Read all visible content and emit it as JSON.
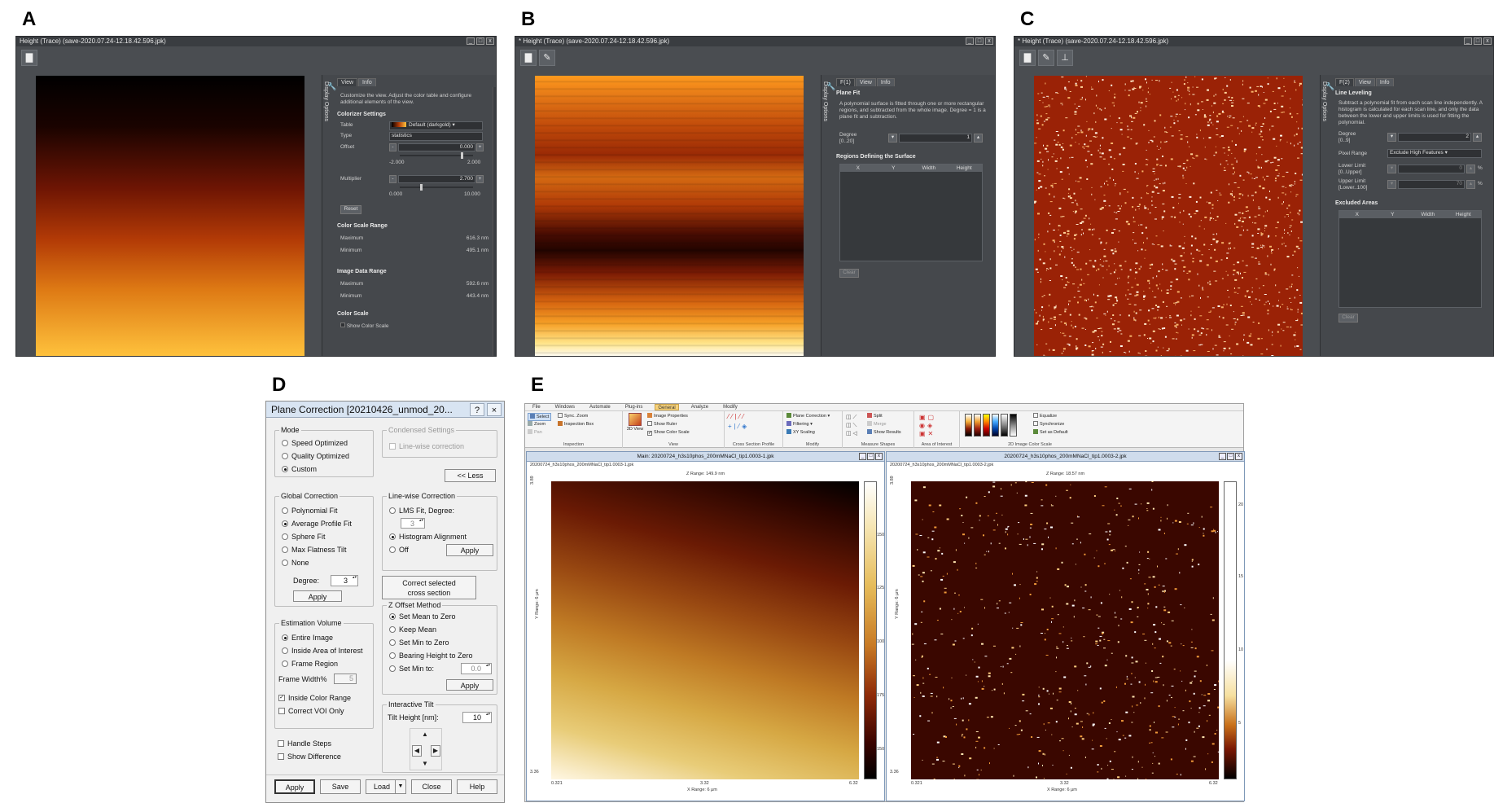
{
  "panel_labels": {
    "a": "A",
    "b": "B",
    "c": "C",
    "d": "D",
    "e": "E"
  },
  "win_a": {
    "title": "Height (Trace) (save-2020.07.24-12.18.42.596.jpk)",
    "side_label": "Display Options",
    "tabs": [
      "View",
      "Info"
    ],
    "intro": "Customize the view. Adjust the color table and configure additional elements of the view.",
    "colorizer_heading": "Colorizer Settings",
    "table_label": "Table",
    "table_value": "Default (darkgold)",
    "type_label": "Type",
    "type_value": "statistics",
    "offset_label": "Offset",
    "offset_value": "0.000",
    "offset_min": "-2.000",
    "offset_max": "2.000",
    "multiplier_label": "Multiplier",
    "multiplier_value": "2.700",
    "mult_min": "0.000",
    "mult_max": "10.000",
    "reset_label": "Reset",
    "csr_heading": "Color Scale Range",
    "csr_max_label": "Maximum",
    "csr_max_value": "616.3 nm",
    "csr_min_label": "Minimum",
    "csr_min_value": "495.1 nm",
    "idr_heading": "Image Data Range",
    "idr_max_label": "Maximum",
    "idr_max_value": "592.6 nm",
    "idr_min_label": "Minimum",
    "idr_min_value": "443.4 nm",
    "cs_heading": "Color Scale",
    "show_cs_label": "Show Color Scale"
  },
  "win_b": {
    "title": "* Height (Trace) (save-2020.07.24-12.18.42.596.jpk)",
    "side_label": "Display Options",
    "tabs": [
      "F(1)",
      "View",
      "Info"
    ],
    "heading": "Plane Fit",
    "intro": "A polynomial surface is fitted through one or more rectangular regions, and subtracted from the whole image. Degree = 1 is a plane fit and subtraction.",
    "degree_label": "Degree",
    "degree_range": "[0..20]",
    "degree_value": "1",
    "regions_heading": "Regions Defining the Surface",
    "cols": [
      "X",
      "Y",
      "Width",
      "Height"
    ],
    "clear_label": "Clear"
  },
  "win_c": {
    "title": "* Height (Trace) (save-2020.07.24-12.18.42.596.jpk)",
    "side_label": "Display Options",
    "tabs": [
      "F(2)",
      "View",
      "Info"
    ],
    "heading": "Line Leveling",
    "intro": "Subtract a polynomial fit from each scan line independently. A histogram is calculated for each scan line, and only the data between the lower and upper limits is used for fitting the polynomial.",
    "degree_label": "Degree",
    "degree_range": "[0..9]",
    "degree_value": "2",
    "pixel_label": "Pixel Range",
    "pixel_value": "Exclude High Features",
    "lower_label": "Lower Limit",
    "lower_range": "[0..Upper]",
    "lower_value": "0",
    "upper_label": "Upper Limit",
    "upper_range": "[Lower..100]",
    "upper_value": "70",
    "pct": "%",
    "excluded_heading": "Excluded Areas",
    "cols": [
      "X",
      "Y",
      "Width",
      "Height"
    ],
    "clear_label": "Clear"
  },
  "pc": {
    "title": "Plane Correction [20210426_unmod_20...",
    "help_q": "?",
    "close_x": "×",
    "mode_label": "Mode",
    "mode_opts": [
      "Speed Optimized",
      "Quality Optimized",
      "Custom"
    ],
    "condensed_label": "Condensed Settings",
    "linewise_check": "Line-wise correction",
    "less_btn": "<< Less",
    "global_label": "Global Correction",
    "global_opts": [
      "Polynomial Fit",
      "Average Profile Fit",
      "Sphere Fit",
      "Max Flatness Tilt",
      "None"
    ],
    "degree_label": "Degree:",
    "degree_value": "3",
    "apply": "Apply",
    "lw_label": "Line-wise Correction",
    "lw_opts": [
      "LMS Fit, Degree:",
      "Histogram Alignment",
      "Off"
    ],
    "lw_degree": "3",
    "correct_btn_1": "Correct selected",
    "correct_btn_2": "cross section",
    "est_label": "Estimation Volume",
    "est_opts": [
      "Entire Image",
      "Inside Area of Interest",
      "Frame Region"
    ],
    "frame_label": "Frame Width%",
    "frame_value": "5",
    "inside_color": "Inside Color Range",
    "correct_voi": "Correct VOI Only",
    "z_label": "Z Offset Method",
    "z_opts": [
      "Set Mean to Zero",
      "Keep Mean",
      "Set Min to Zero",
      "Bearing Height to Zero",
      "Set Min to:"
    ],
    "z_value": "0.0",
    "tilt_label": "Interactive Tilt",
    "tilt_height_label": "Tilt Height [nm]:",
    "tilt_height_value": "10",
    "handle_steps": "Handle Steps",
    "show_diff": "Show Difference",
    "btns": [
      "Apply",
      "Save",
      "Load",
      "Close",
      "Help"
    ]
  },
  "ev": {
    "menu": [
      "File",
      "Windows",
      "Automate",
      "Plug-ins",
      "General",
      "Analyze",
      "Modify"
    ],
    "rib": {
      "select": "Select",
      "zoom": "Zoom",
      "pan": "Pan",
      "sync_zoom": "Sync. Zoom",
      "insp_box": "Inspection Box",
      "inspection": "Inspection",
      "view3d": "3D View",
      "img_props": "Image Properties",
      "show_ruler": "Show Ruler",
      "show_cs": "Show Color Scale",
      "view": "View",
      "csp": "Cross Section Profile",
      "plane_corr": "Plane Correction",
      "filtering": "Filtering",
      "xy_scaling": "XY Scaling",
      "modify": "Modify",
      "split": "Split",
      "merge": "Merge",
      "show_results": "Show Results",
      "measure": "Measure Shapes",
      "aoi": "Area of Interest",
      "equalize": "Equalize",
      "synchronize": "Synchronize",
      "set_default": "Set as Default",
      "cscale": "2D Image Color Scale"
    },
    "w1": {
      "title": "Main: 20200724_h3s10phos_200mMNaCl_tip1.0003-1.jpk",
      "sub": "20200724_h3s10phos_200mMNaCl_tip1.0003-1.jpk",
      "zrange": "Z Range:  149.9 nm",
      "yaxis": "Y Range: 6 µm",
      "xaxis": "X Range: 6 µm",
      "x_ticks": [
        "0.321",
        "3.32",
        "6.32"
      ],
      "y_ticks": [
        "3.89",
        "1.98",
        "3.36"
      ],
      "c_ticks": [
        "150",
        "125",
        "100",
        "175",
        "150"
      ]
    },
    "w2": {
      "title": "20200724_h3s10phos_200mMNaCl_tip1.0003-2.jpk",
      "sub": "20200724_h3s10phos_200mMNaCl_tip1.0003-2.jpk",
      "zrange": "Z Range:  18.57 nm",
      "yaxis": "Y Range: 6 µm",
      "xaxis": "X Range: 6 µm",
      "x_ticks": [
        "0.321",
        "3.32",
        "6.32"
      ],
      "y_ticks": [
        "3.89",
        "1.98",
        "3.36"
      ],
      "c_ticks": [
        "20",
        "15",
        "10",
        "5"
      ]
    }
  }
}
